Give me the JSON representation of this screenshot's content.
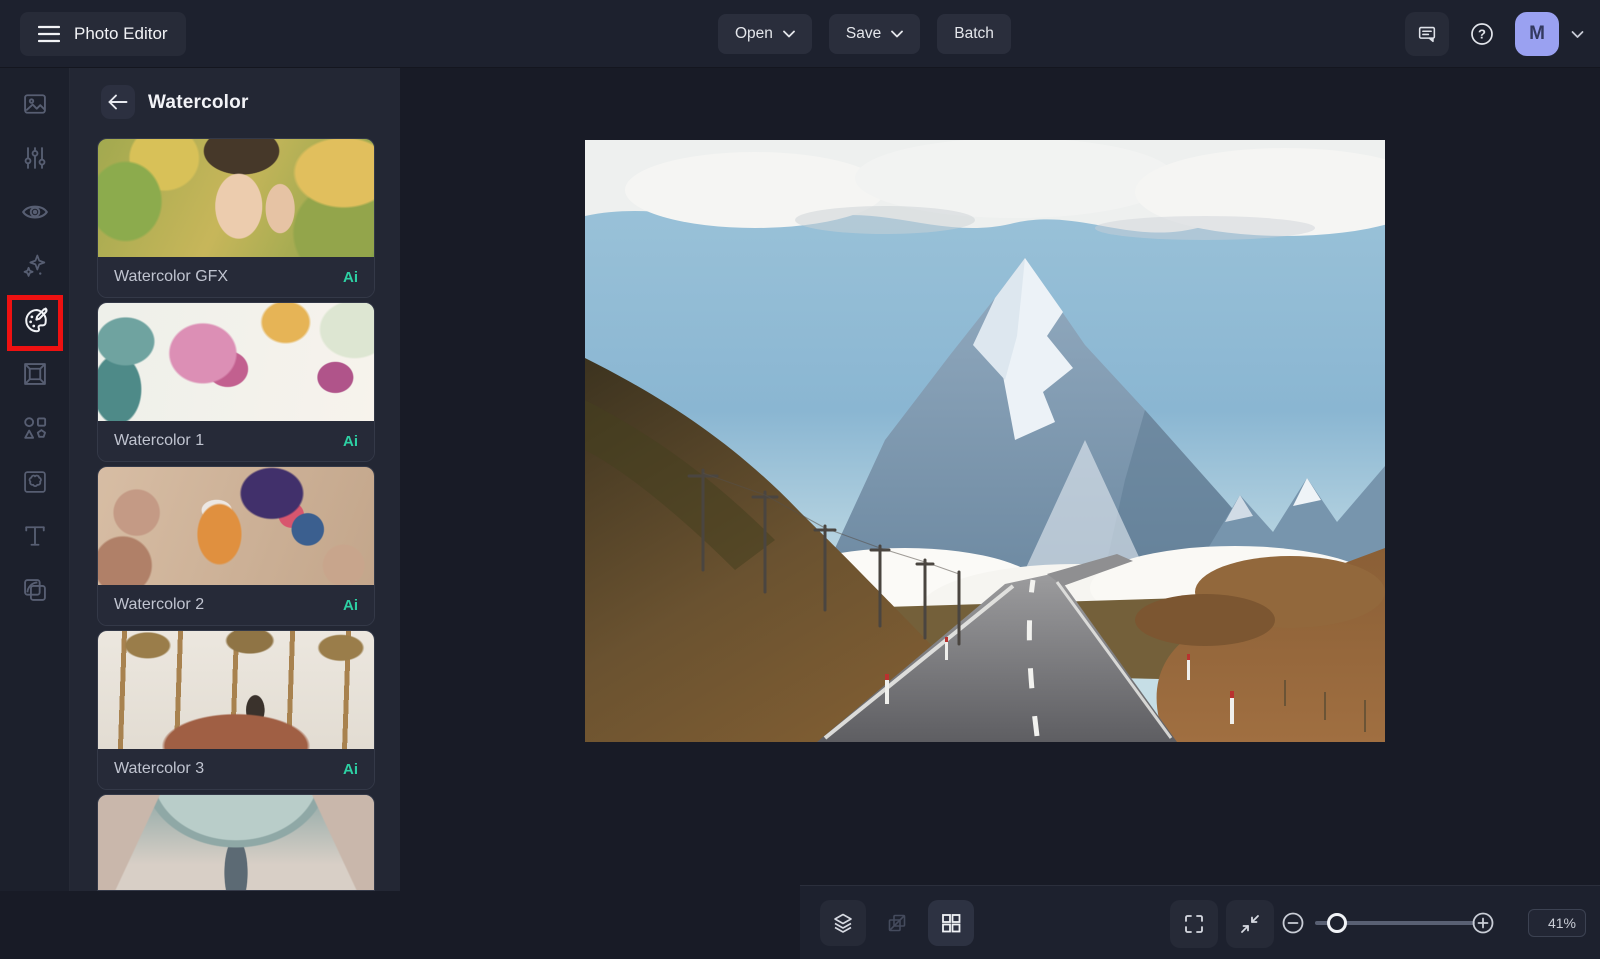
{
  "app_title": "Photo Editor",
  "topbar": {
    "open": "Open",
    "save": "Save",
    "batch": "Batch",
    "avatar_initial": "M",
    "icons": [
      "menu-icon",
      "chevron-down-icon",
      "feedback-icon",
      "help-icon",
      "avatar-chevron-icon"
    ]
  },
  "sidebar": {
    "icons": [
      "image-icon",
      "adjust-sliders-icon",
      "eye-icon",
      "ai-sparkles-icon",
      "palette-icon",
      "frame-icon",
      "shapes-icon",
      "mosaic-icon",
      "text-icon",
      "collage-icon"
    ],
    "active_icon": "palette-icon",
    "annotation_color": "#ee1111"
  },
  "panel": {
    "title": "Watercolor",
    "effects": [
      {
        "label": "Watercolor GFX",
        "badge": "Ai"
      },
      {
        "label": "Watercolor 1",
        "badge": "Ai"
      },
      {
        "label": "Watercolor 2",
        "badge": "Ai"
      },
      {
        "label": "Watercolor 3",
        "badge": "Ai"
      },
      {
        "label": "",
        "badge": ""
      }
    ],
    "badge_color": "#2dd0a3"
  },
  "bottom_toolbar": {
    "zoom_value": "41%",
    "icons_left": [
      "layers-icon",
      "compare-icon",
      "grid-view-icon"
    ],
    "icons_center": [
      "fullscreen-icon",
      "fit-screen-icon",
      "zoom-out-icon",
      "zoom-in-icon"
    ],
    "icons_right": [
      "reset-icon",
      "undo-icon",
      "redo-icon",
      "history-icon"
    ],
    "disabled_icons": [
      "compare-icon",
      "undo-icon",
      "redo-icon"
    ]
  },
  "colors": {
    "avatar_bg": "#9aa1f1",
    "ai_badge": "#2dd0a3",
    "annotation_red": "#ee1111",
    "topbar_bg": "#1d212e",
    "panel_bg": "#232734",
    "canvas_bg": "#181b26"
  }
}
